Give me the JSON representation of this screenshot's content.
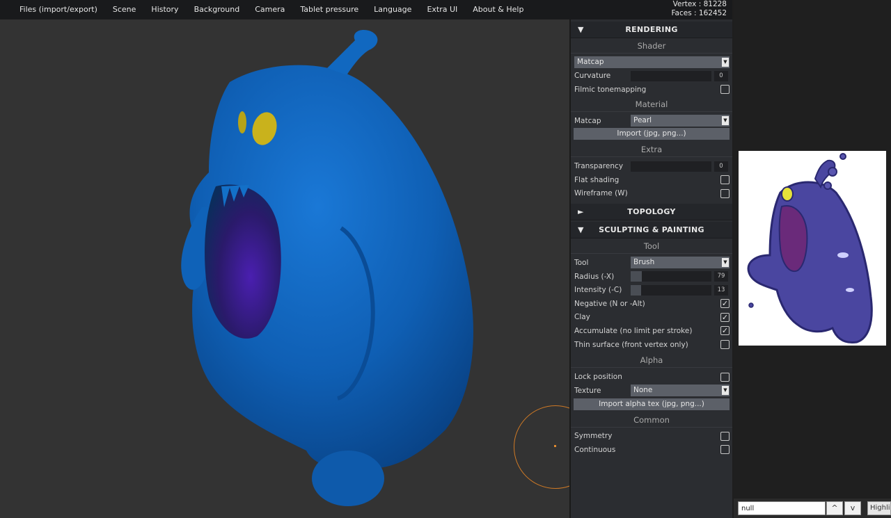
{
  "menu": [
    "Files (import/export)",
    "Scene",
    "History",
    "Background",
    "Camera",
    "Tablet pressure",
    "Language",
    "Extra UI",
    "About & Help"
  ],
  "stats": {
    "vertex": "Vertex : 81228",
    "faces": "Faces : 162452"
  },
  "rendering": {
    "title": "RENDERING",
    "arrow": "▼",
    "shader_title": "Shader",
    "shader_select": "Matcap",
    "curvature_label": "Curvature",
    "curvature_value": "0",
    "curvature_level": 0,
    "filmic_label": "Filmic tonemapping",
    "filmic_checked": false,
    "material_title": "Material",
    "matcap_label": "Matcap",
    "matcap_select": "Pearl",
    "import_matcap": "Import (jpg, png...)",
    "extra_title": "Extra",
    "transparency_label": "Transparency",
    "transparency_value": "0",
    "transparency_level": 0,
    "flat_label": "Flat shading",
    "flat_checked": false,
    "wireframe_label": "Wireframe (W)",
    "wireframe_checked": false
  },
  "topology": {
    "title": "TOPOLOGY",
    "arrow": "►"
  },
  "sculpting": {
    "title": "SCULPTING & PAINTING",
    "arrow": "▼",
    "tool_title": "Tool",
    "tool_label": "Tool",
    "tool_select": "Brush",
    "radius_label": "Radius (-X)",
    "radius_value": "79",
    "radius_level": 0.14,
    "intensity_label": "Intensity (-C)",
    "intensity_value": "13",
    "intensity_level": 0.13,
    "negative_label": "Negative (N or -Alt)",
    "negative_checked": true,
    "clay_label": "Clay",
    "clay_checked": true,
    "accumulate_label": "Accumulate (no limit per stroke)",
    "accumulate_checked": true,
    "thin_label": "Thin surface (front vertex only)",
    "thin_checked": false,
    "alpha_title": "Alpha",
    "lock_label": "Lock position",
    "lock_checked": false,
    "texture_label": "Texture",
    "texture_select": "None",
    "import_alpha": "Import alpha tex (jpg, png...)",
    "common_title": "Common",
    "symmetry_label": "Symmetry",
    "symmetry_checked": false,
    "continuous_label": "Continuous",
    "continuous_checked": false
  },
  "findbar": {
    "value": "null",
    "up": "^",
    "down": "v",
    "highlight": "Highlig"
  },
  "colors": {
    "sculpt_blue": "#0f5fb4",
    "accent_orange": "#d07a25",
    "panel_bg": "#2b2d31",
    "viewport_bg": "#333333"
  },
  "icons": {
    "up": "chevron-up-icon",
    "down": "chevron-down-icon",
    "caret": "caret-down-icon"
  }
}
